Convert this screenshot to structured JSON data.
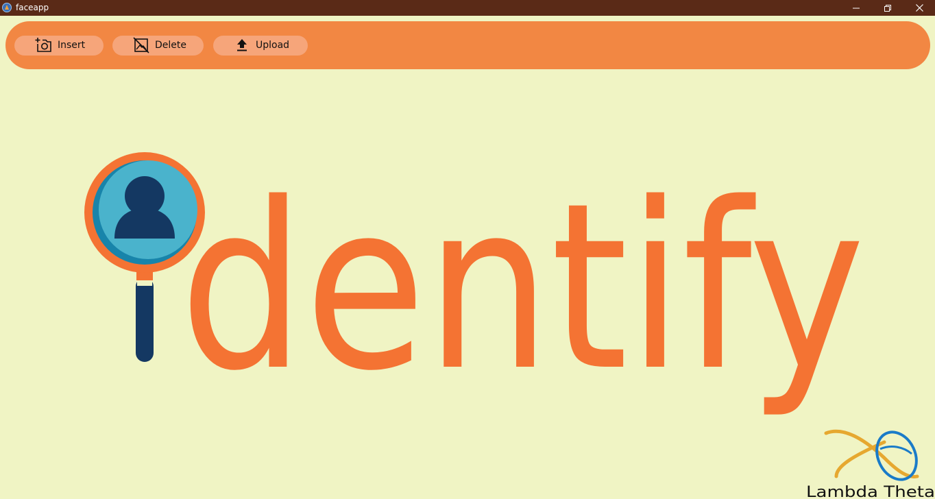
{
  "window": {
    "title": "faceapp",
    "icon": "app-icon"
  },
  "toolbar": {
    "buttons": [
      {
        "id": "insert",
        "label": "Insert",
        "icon": "camera-add-icon"
      },
      {
        "id": "delete",
        "label": "Delete",
        "icon": "image-delete-icon"
      },
      {
        "id": "upload",
        "label": "Upload",
        "icon": "upload-icon"
      }
    ]
  },
  "logo": {
    "wordmark": "dentify",
    "icon": "magnifier-person-icon"
  },
  "brand": {
    "name": "Lambda Theta",
    "icon": "lambda-theta-logo-icon"
  },
  "colors": {
    "background": "#f0f4c4",
    "titlebar": "#5a2a17",
    "toolbar": "#f28743",
    "button": "#f6a57a",
    "wordmark": "#f47333",
    "lens": "#4ab3cc",
    "person": "#143862",
    "brand_gold": "#e6a830",
    "brand_blue": "#1a7bc8"
  }
}
